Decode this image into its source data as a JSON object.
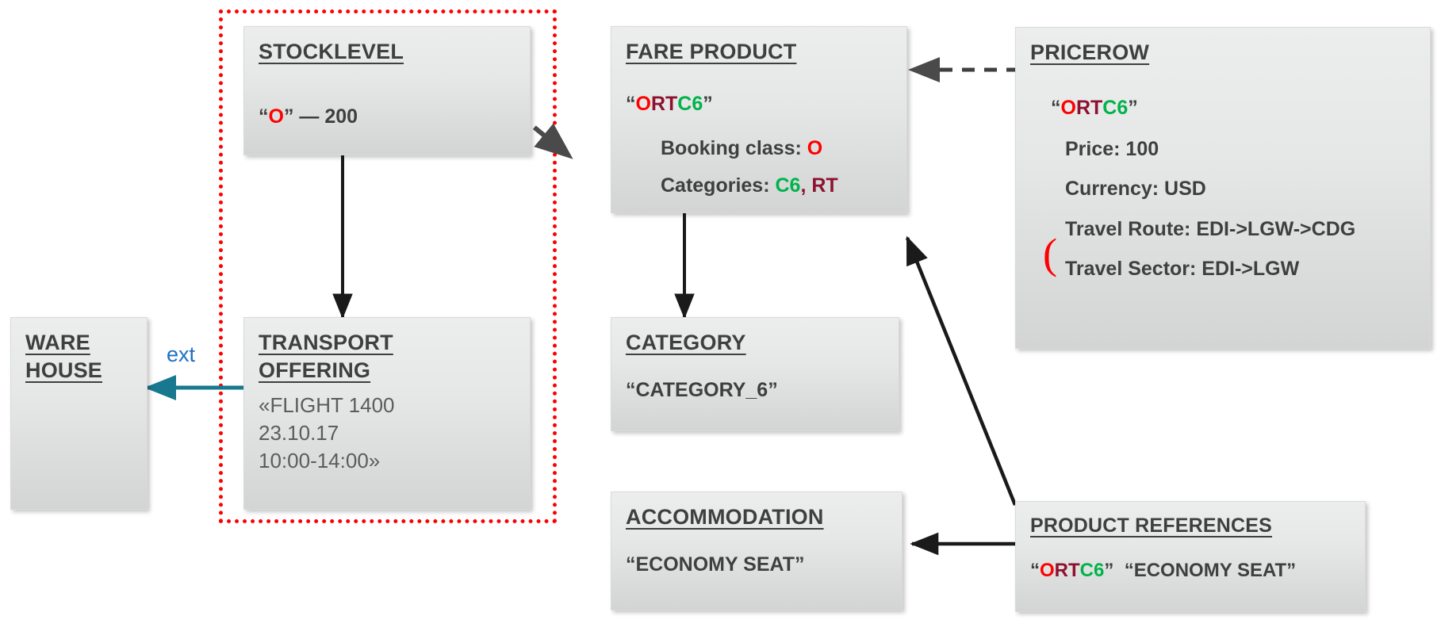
{
  "diagram": {
    "title": "Airline offer data model relationships",
    "colors": {
      "box_fill_top": "#eceded",
      "box_fill_bottom": "#d3d4d4",
      "text": "#3f3f3f",
      "accent_red": "#ff0000",
      "accent_maroon": "#8d1230",
      "accent_green": "#00b34a",
      "ext_link": "#1f6fc4",
      "group_border": "#ff0000"
    }
  },
  "boxes": {
    "warehouse": {
      "title_line1": "WARE",
      "title_line2": "HOUSE"
    },
    "stocklevel": {
      "title": "STOCKLEVEL",
      "value_quote_open": "“",
      "value_code": "O",
      "value_quote_close": "”",
      "value_rest": " — 200"
    },
    "transport_offering": {
      "title_line1": "TRANSPORT",
      "title_line2": "OFFERING",
      "line1": "«FLIGHT 1400",
      "line2": "23.10.17",
      "line3": "10:00-14:00»"
    },
    "fare_product": {
      "title": "FARE PRODUCT",
      "code_quote_open": "“",
      "code_part_o": "O",
      "code_part_rt": "RT",
      "code_part_c6": "C6",
      "code_quote_close": "”",
      "booking_class_label": "Booking class: ",
      "booking_class_value": "O",
      "categories_label": "Categories: ",
      "categories_value_c6": "C6",
      "categories_separator": ", ",
      "categories_value_rt": "RT"
    },
    "category": {
      "title": "CATEGORY",
      "value": "“CATEGORY_6”"
    },
    "accommodation": {
      "title": "ACCOMMODATION",
      "value": "“ECONOMY SEAT”"
    },
    "pricerow": {
      "title": "PRICEROW",
      "code_quote_open": "“",
      "code_part_o": "O",
      "code_part_rt": "RT",
      "code_part_c6": "C6",
      "code_quote_close": "”",
      "price": "Price: 100",
      "currency": "Currency: USD",
      "travel_route": "Travel Route: EDI->LGW->CDG",
      "travel_sector": "Travel Sector: EDI->LGW",
      "paren_mark": "("
    },
    "product_references": {
      "title": "PRODUCT REFERENCES",
      "code_quote_open": "“",
      "code_part_o": "O",
      "code_part_rt": "RT",
      "code_part_c6": "C6",
      "code_quote_close": "”",
      "second_value": "  “ECONOMY SEAT”"
    }
  },
  "labels": {
    "ext": "ext"
  },
  "connectors": [
    {
      "name": "stocklevel-to-transport-offering",
      "style": "solid",
      "color": "#1a1a1a"
    },
    {
      "name": "stocklevel-to-fare-product",
      "style": "dashed",
      "color": "#4a4a4a"
    },
    {
      "name": "fare-product-to-category",
      "style": "solid",
      "color": "#1a1a1a"
    },
    {
      "name": "pricerow-to-fare-product",
      "style": "dashed",
      "color": "#3f3f3f"
    },
    {
      "name": "product-references-to-fare-product",
      "style": "solid",
      "color": "#1a1a1a"
    },
    {
      "name": "product-references-to-accommodation",
      "style": "solid",
      "color": "#1a1a1a"
    },
    {
      "name": "transport-offering-to-warehouse",
      "style": "solid",
      "color": "#17788f"
    }
  ]
}
